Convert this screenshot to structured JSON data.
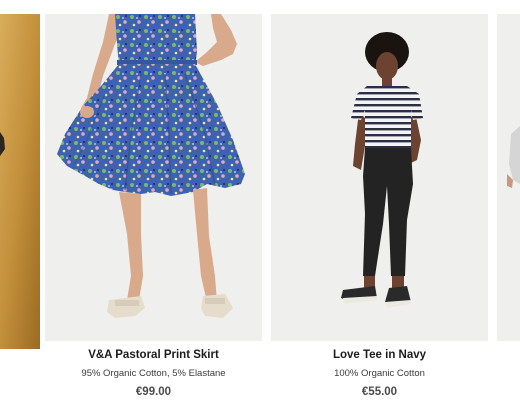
{
  "products": [
    {
      "title": "",
      "material": "",
      "price": "",
      "image": "model-in-gold-backdrop-photo"
    },
    {
      "title": "V&A Pastoral Print Skirt",
      "material": "95% Organic Cotton, 5% Elastane",
      "price": "€99.00",
      "image": "floral-print-skirt-photo"
    },
    {
      "title": "Love Tee in Navy",
      "material": "100% Organic Cotton",
      "price": "€55.00",
      "image": "striped-tee-and-black-trousers-photo"
    },
    {
      "title": "",
      "material": "",
      "price": "",
      "image": "partial-model-photo"
    }
  ],
  "colors": {
    "gold_backdrop": "#c99a45",
    "studio_backdrop": "#eeeeec",
    "skirt_blue": "#3d63b0",
    "text_dark": "#1b1b1b",
    "price_grey": "#4a4a4a"
  }
}
